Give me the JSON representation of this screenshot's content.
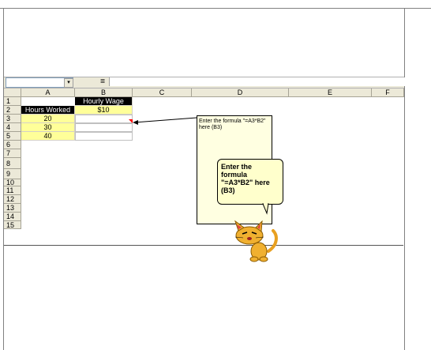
{
  "formula_bar": {
    "equals_label": "=",
    "dropdown_glyph": "▾"
  },
  "columns": [
    "A",
    "B",
    "C",
    "D",
    "E",
    "F"
  ],
  "rows": [
    "1",
    "2",
    "3",
    "4",
    "5",
    "6",
    "7",
    "8",
    "9",
    "10",
    "11",
    "12",
    "13",
    "14",
    "15"
  ],
  "cells": {
    "B1": "Hourly Wage",
    "A2": "Hours Worked",
    "B2": "$10",
    "A3": "20",
    "A4": "30",
    "A5": "40"
  },
  "comment": {
    "text": "Enter the formula \"=A3*B2\" here (B3)"
  },
  "balloon": {
    "text": "Enter the formula \"=A3*B2\" here (B3)"
  },
  "colors": {
    "header_black": "#000000",
    "highlight_yellow": "#ffff99",
    "comment_bg": "#ffffe1",
    "arrow": "#000000",
    "comment_indicator": "#ff0000"
  },
  "icons": [
    "dropdown-arrow-icon",
    "cat-assistant-icon"
  ]
}
